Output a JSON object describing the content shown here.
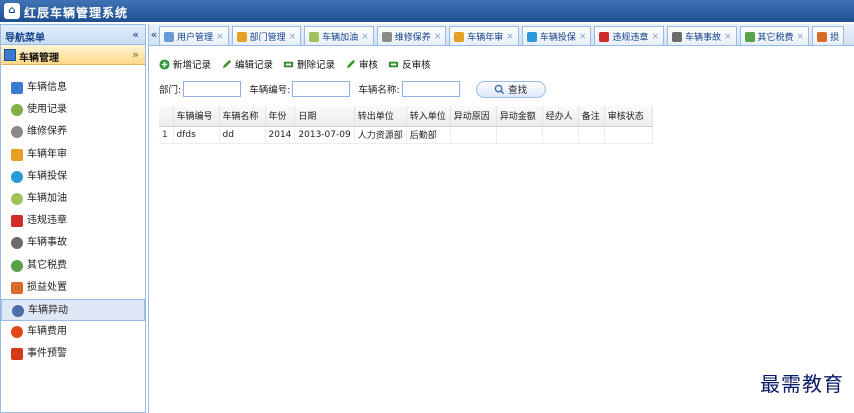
{
  "app": {
    "title": "红辰车辆管理系统"
  },
  "sidebar": {
    "header": "导航菜单",
    "collapse_glyph": "«",
    "group": "车辆管理",
    "group_glyph": "»",
    "items": [
      {
        "label": "车辆信息",
        "icon": "vehicle-info-icon",
        "color": "#3d7bd0"
      },
      {
        "label": "使用记录",
        "icon": "usage-record-icon",
        "color": "#7fb04a"
      },
      {
        "label": "维修保养",
        "icon": "repair-icon",
        "color": "#8a8a8a"
      },
      {
        "label": "车辆年审",
        "icon": "annual-review-icon",
        "color": "#e6a023"
      },
      {
        "label": "车辆投保",
        "icon": "insurance-icon",
        "color": "#2a9bd8"
      },
      {
        "label": "车辆加油",
        "icon": "fuel-icon",
        "color": "#9fc25a"
      },
      {
        "label": "违规违章",
        "icon": "violation-icon",
        "color": "#d22b2b"
      },
      {
        "label": "车辆事故",
        "icon": "accident-icon",
        "color": "#6b6b6b"
      },
      {
        "label": "其它税费",
        "icon": "tax-icon",
        "color": "#5aa24a"
      },
      {
        "label": "损益处置",
        "icon": "disposal-icon",
        "color": "#d86a2a"
      },
      {
        "label": "车辆异动",
        "icon": "vehicle-transfer-icon",
        "color": "#4b6ea8",
        "active": true
      },
      {
        "label": "车辆费用",
        "icon": "expense-icon",
        "color": "#e04a1a"
      },
      {
        "label": "事件预警",
        "icon": "alert-icon",
        "color": "#d23a1a"
      }
    ]
  },
  "tabs": {
    "scroll_glyph": "«",
    "items": [
      {
        "label": "用户管理",
        "color": "#6a9bd8"
      },
      {
        "label": "部门管理",
        "color": "#e6a023"
      },
      {
        "label": "车辆加油",
        "color": "#9fc25a"
      },
      {
        "label": "维修保养",
        "color": "#8a8a8a"
      },
      {
        "label": "车辆年审",
        "color": "#e6a023"
      },
      {
        "label": "车辆投保",
        "color": "#2a9bd8"
      },
      {
        "label": "违规违章",
        "color": "#d22b2b"
      },
      {
        "label": "车辆事故",
        "color": "#6b6b6b"
      },
      {
        "label": "其它税费",
        "color": "#5aa24a"
      },
      {
        "label": "损",
        "color": "#d86a2a"
      }
    ],
    "close_glyph": "×"
  },
  "toolbar": {
    "add": "新增记录",
    "edit": "编辑记录",
    "delete": "删除记录",
    "approve": "审核",
    "unapprove": "反审核"
  },
  "search": {
    "dept_label": "部门:",
    "code_label": "车辆编号:",
    "name_label": "车辆名称:",
    "button": "查找"
  },
  "grid": {
    "columns": [
      "车辆编号",
      "车辆名称",
      "年份",
      "日期",
      "转出单位",
      "转入单位",
      "异动原因",
      "异动金额",
      "经办人",
      "备注",
      "审核状态"
    ],
    "rows": [
      {
        "rn": "1",
        "cells": [
          "dfds",
          "dd",
          "2014",
          "2013-07-09",
          "人力资源部",
          "后勤部",
          "",
          "",
          "",
          "",
          ""
        ]
      }
    ]
  },
  "watermark": "最需教育"
}
